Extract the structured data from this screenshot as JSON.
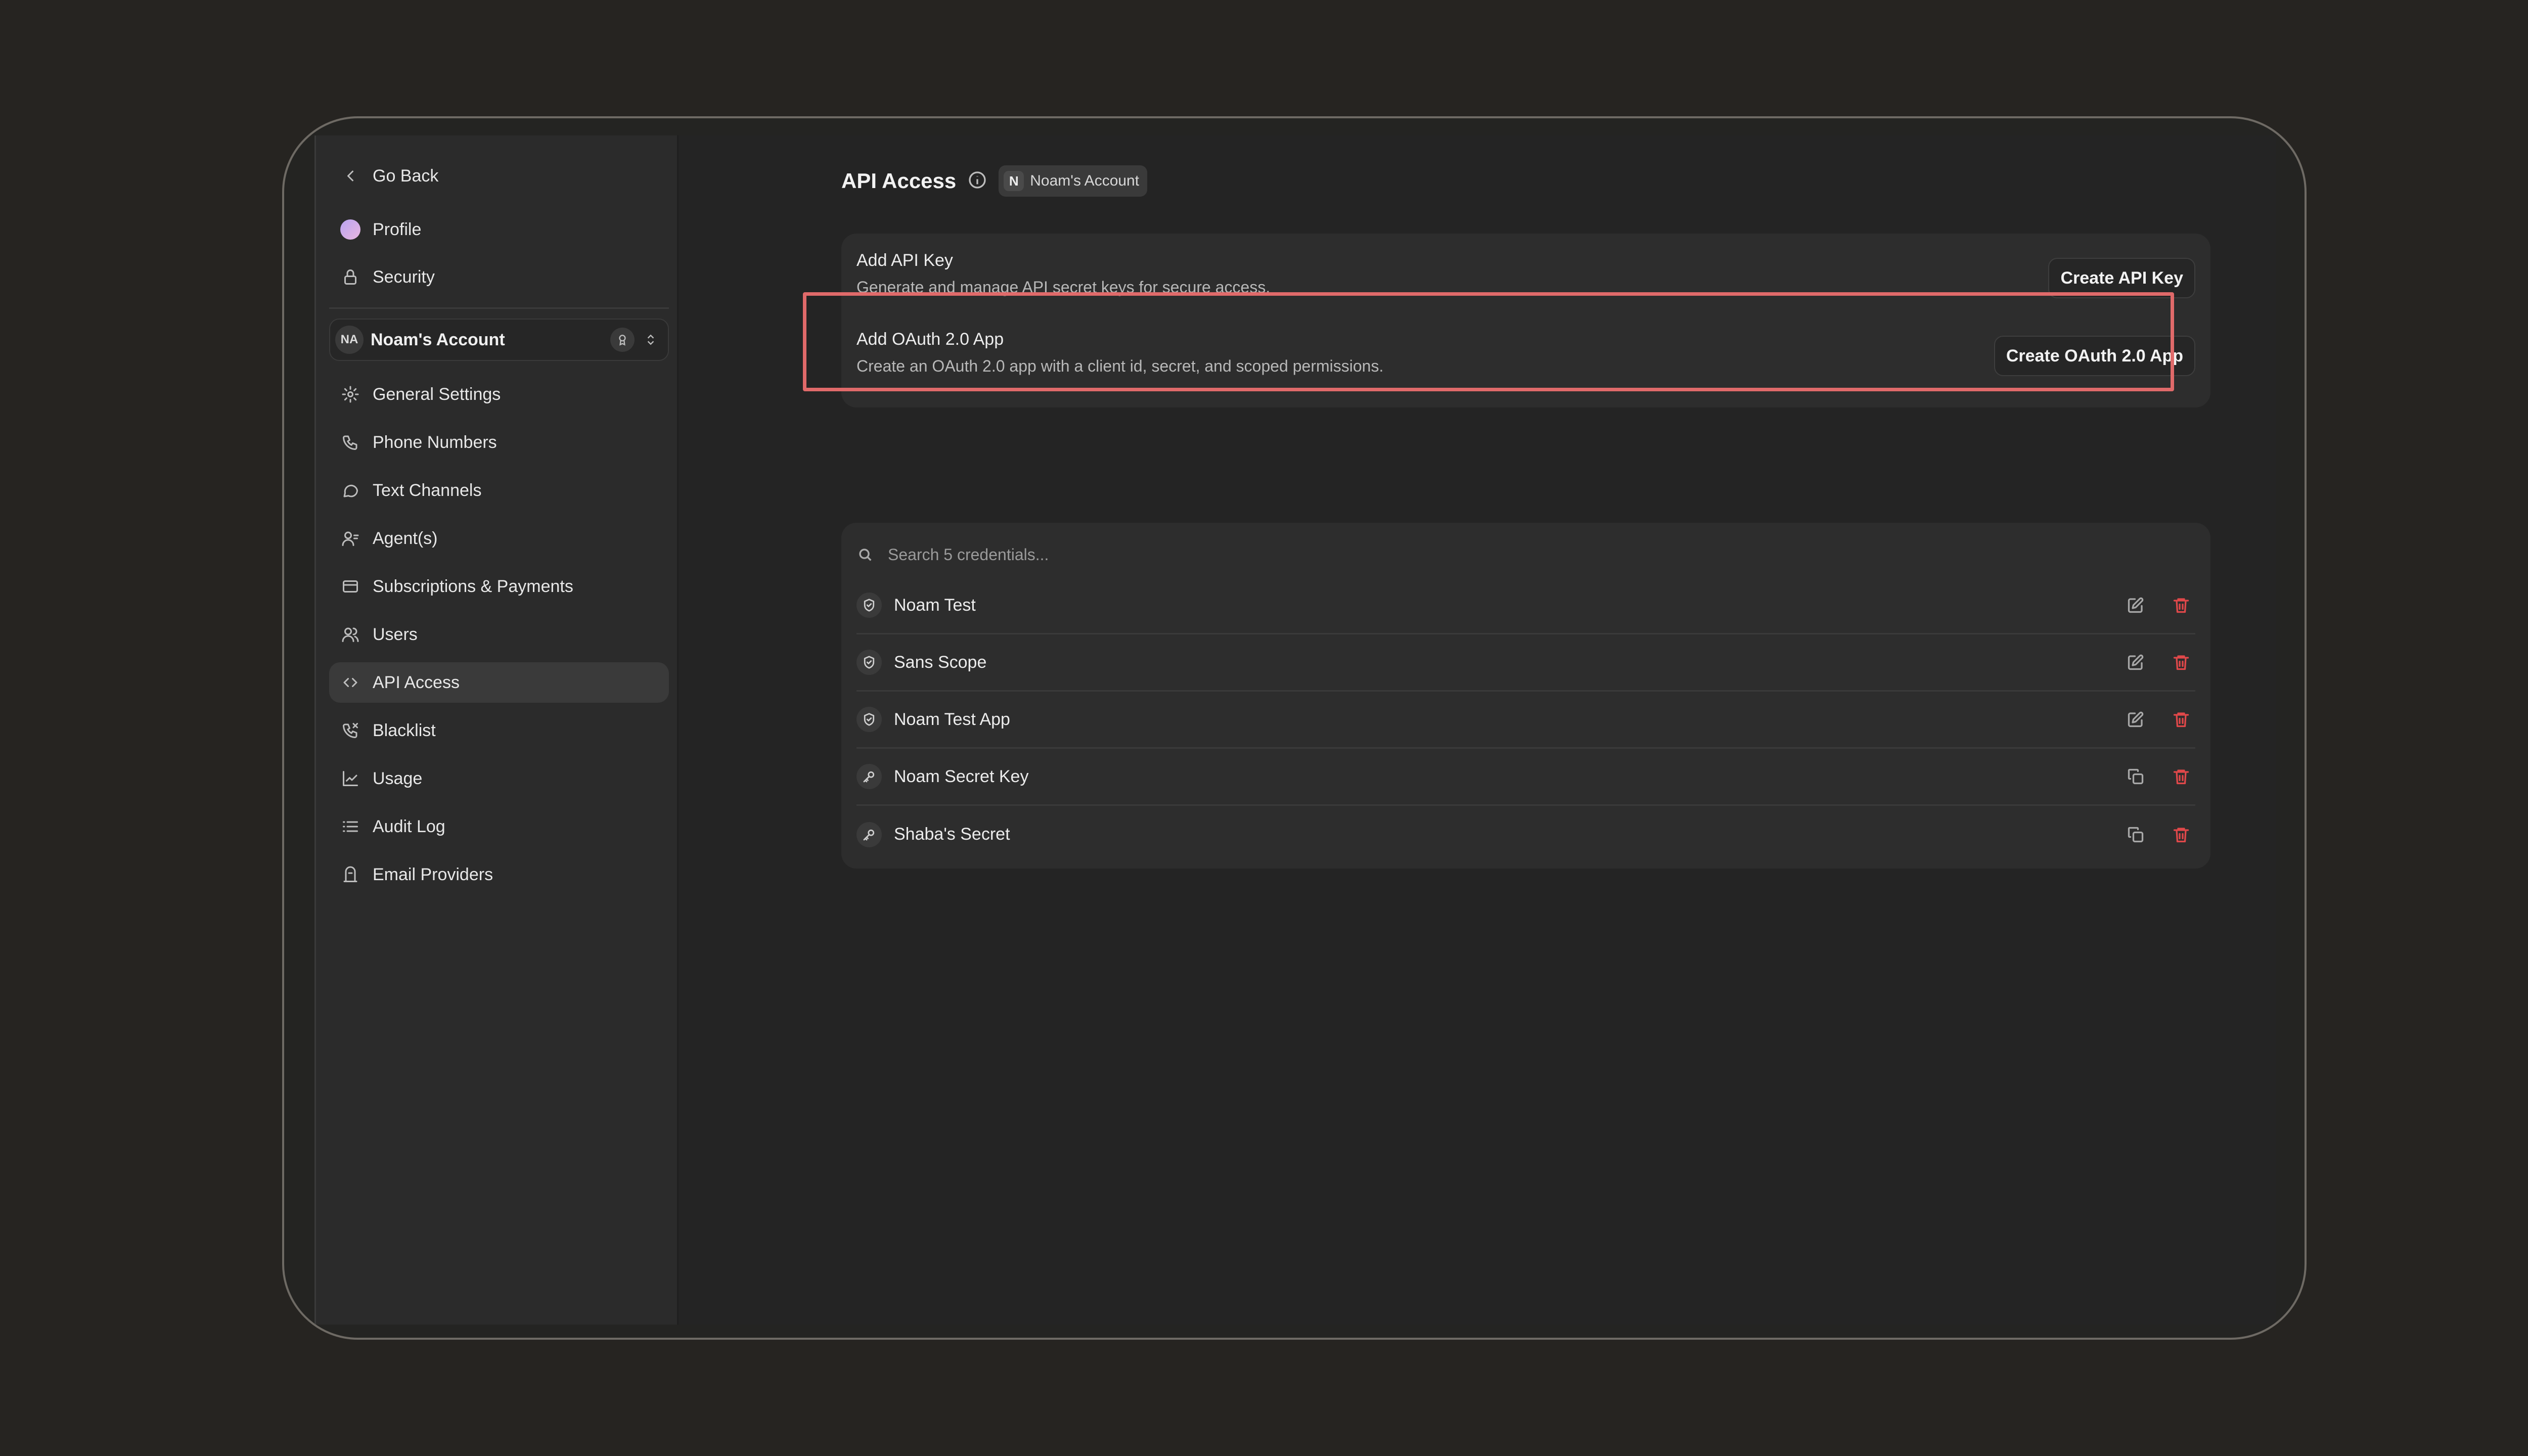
{
  "sidebar": {
    "go_back": "Go Back",
    "profile": "Profile",
    "security": "Security",
    "account": {
      "initials": "NA",
      "name": "Noam's Account"
    },
    "items": [
      {
        "label": "General Settings",
        "icon": "gear-icon"
      },
      {
        "label": "Phone Numbers",
        "icon": "phone-numbers-icon"
      },
      {
        "label": "Text Channels",
        "icon": "chat-icon"
      },
      {
        "label": "Agent(s)",
        "icon": "agent-icon"
      },
      {
        "label": "Subscriptions & Payments",
        "icon": "credit-card-icon"
      },
      {
        "label": "Users",
        "icon": "users-icon"
      },
      {
        "label": "API Access",
        "icon": "code-icon",
        "active": true
      },
      {
        "label": "Blacklist",
        "icon": "phone-blocked-icon"
      },
      {
        "label": "Usage",
        "icon": "chart-icon"
      },
      {
        "label": "Audit Log",
        "icon": "list-icon"
      },
      {
        "label": "Email Providers",
        "icon": "mailbox-icon"
      }
    ]
  },
  "header": {
    "title": "API Access",
    "chip_initial": "N",
    "chip_label": "Noam's Account"
  },
  "cards": {
    "api_key": {
      "title": "Add API Key",
      "description": "Generate and manage API secret keys for secure access.",
      "button": "Create API Key"
    },
    "oauth": {
      "title": "Add OAuth 2.0 App",
      "description": "Create an OAuth 2.0 app with a client id, secret, and scoped permissions.",
      "button": "Create OAuth 2.0 App"
    }
  },
  "credentials": {
    "search_placeholder": "Search 5 credentials...",
    "rows": [
      {
        "name": "Noam Test",
        "icon": "shield-icon",
        "action": "edit-icon"
      },
      {
        "name": "Sans Scope",
        "icon": "shield-icon",
        "action": "edit-icon"
      },
      {
        "name": "Noam Test App",
        "icon": "shield-icon",
        "action": "edit-icon"
      },
      {
        "name": "Noam Secret Key",
        "icon": "key-icon",
        "action": "copy-icon"
      },
      {
        "name": "Shaba's Secret",
        "icon": "key-icon",
        "action": "copy-icon"
      }
    ]
  },
  "colors": {
    "highlight": "#E06A6A",
    "delete": "#E0484A"
  }
}
